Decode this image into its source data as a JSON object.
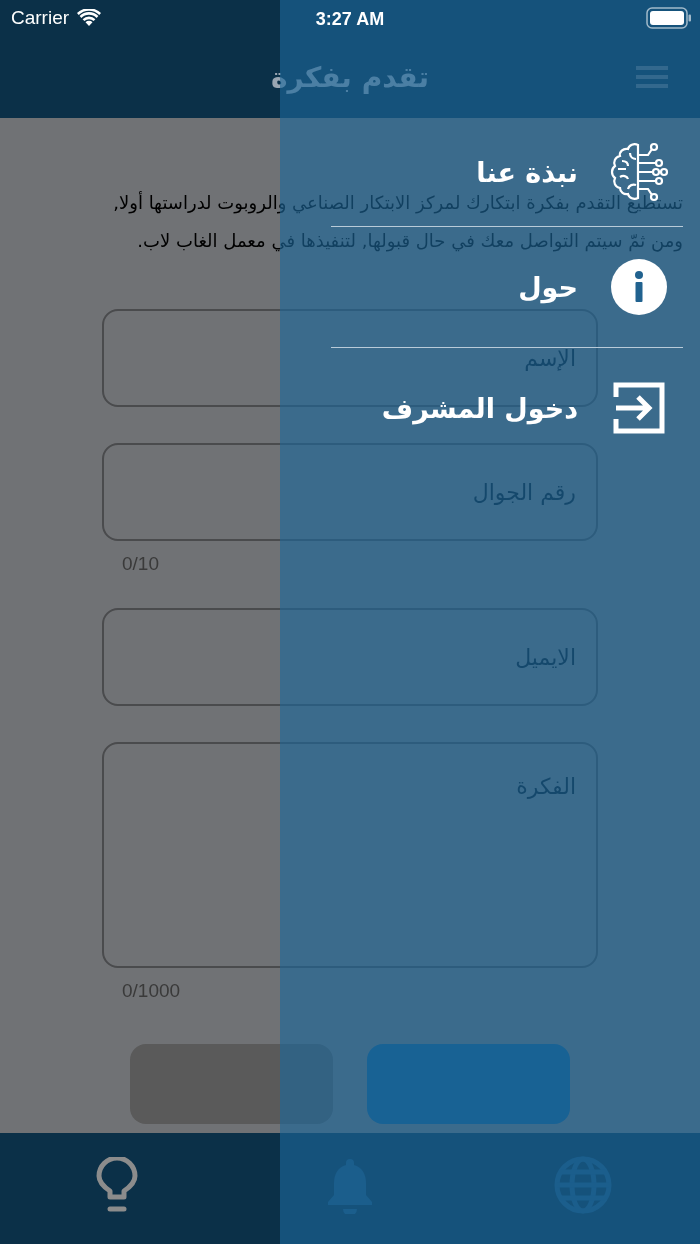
{
  "status_bar": {
    "carrier": "Carrier",
    "time": "3:27 AM"
  },
  "nav": {
    "title": "تقدم بفكرة"
  },
  "intro": "تستطيع التقدم بفكرة ابتكارك لمركز الابتكار الصناعي والروبوت لدراستها أولا, ومن ثمّ سيتم التواصل معك في حال قبولها, لتنفيذها في معمل الغاب لاب.",
  "fields": [
    {
      "placeholder": "الإسم",
      "kind": "line"
    },
    {
      "placeholder": "رقم الجوال",
      "kind": "line",
      "counter": "0/10"
    },
    {
      "placeholder": "الايميل",
      "kind": "line"
    },
    {
      "placeholder": "الفكرة",
      "kind": "multiline",
      "counter": "0/1000"
    }
  ],
  "buttons": [
    {
      "kind": "secondary"
    },
    {
      "kind": "primary"
    }
  ],
  "tabs": [
    {
      "selected": true
    },
    {
      "selected": false
    },
    {
      "selected": false
    }
  ],
  "drawer": {
    "items": [
      {
        "label": "نبذة عنا"
      },
      {
        "label": "حول"
      },
      {
        "label": "دخول المشرف"
      }
    ]
  }
}
